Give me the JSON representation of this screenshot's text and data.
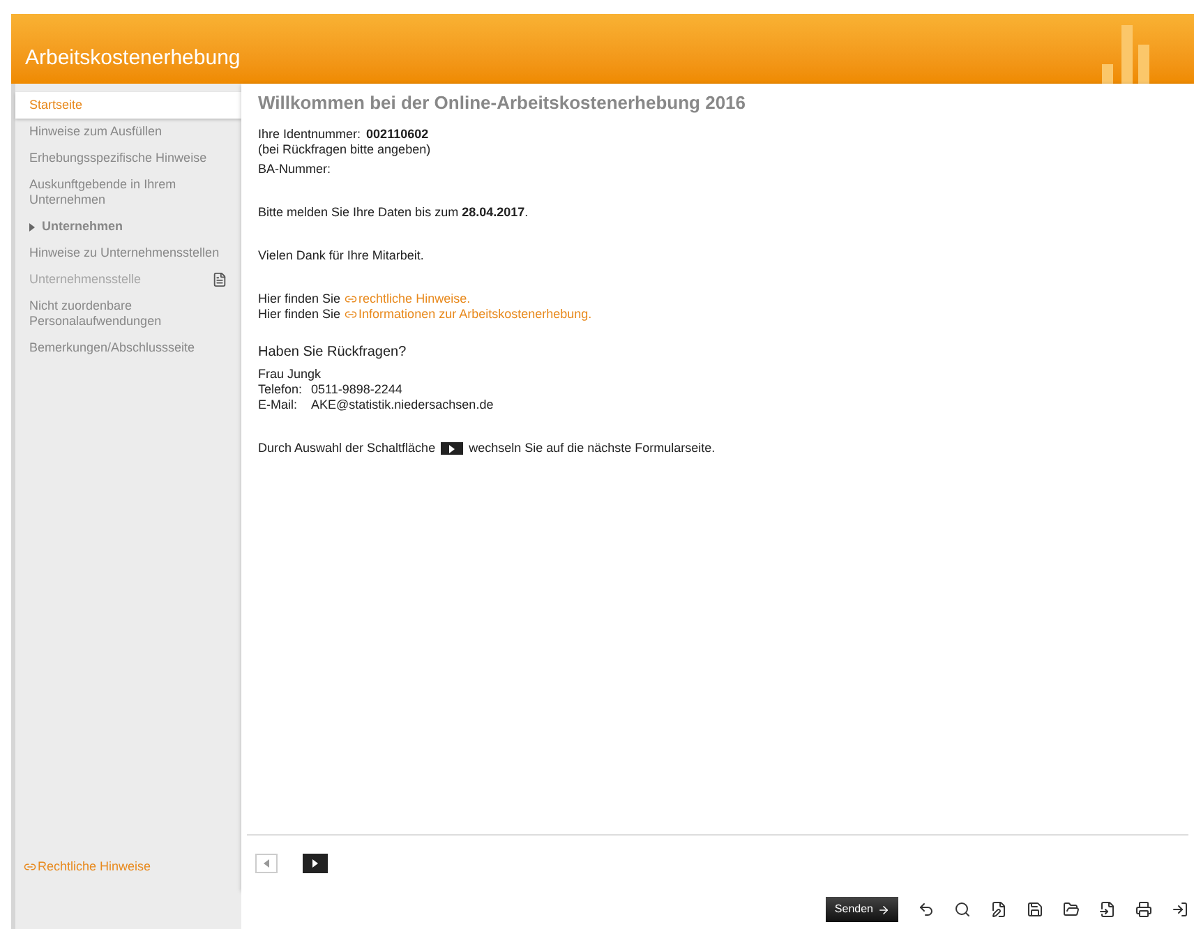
{
  "header": {
    "title": "Arbeitskostenerhebung"
  },
  "sidebar": {
    "items": [
      {
        "label": "Startseite",
        "kind": "item",
        "selected": true,
        "disabled": false
      },
      {
        "label": "Hinweise zum Ausfüllen",
        "kind": "item",
        "selected": false,
        "disabled": false
      },
      {
        "label": "Erhebungsspezifische Hinweise",
        "kind": "item",
        "selected": false,
        "disabled": false
      },
      {
        "label": "Auskunftgebende in Ihrem Unternehmen",
        "kind": "item",
        "selected": false,
        "disabled": false
      },
      {
        "label": "Unternehmen",
        "kind": "group",
        "selected": false,
        "disabled": false
      },
      {
        "label": "Hinweise zu Unternehmensstellen",
        "kind": "item",
        "selected": false,
        "disabled": false
      },
      {
        "label": "Unternehmensstelle",
        "kind": "page",
        "selected": false,
        "disabled": true
      },
      {
        "label": "Nicht zuordenbare Personalaufwendungen",
        "kind": "item",
        "selected": false,
        "disabled": false
      },
      {
        "label": "Bemerkungen/Abschlussseite",
        "kind": "item",
        "selected": false,
        "disabled": false
      }
    ],
    "footer_link": "Rechtliche Hinweise"
  },
  "content": {
    "heading": "Willkommen bei der Online-Arbeitskostenerhebung 2016",
    "id_label": "Ihre Identnummer:",
    "id_value": "002110602",
    "id_note": "(bei Rückfragen bitte angeben)",
    "ba_label": "BA-Nummer:",
    "deadline": "Bitte melden Sie Ihre Daten bis zum **28.04.2017**.",
    "thanks": "Vielen Dank für Ihre Mitarbeit.",
    "links": [
      {
        "prefix": "Hier finden Sie",
        "link": "rechtliche Hinweise."
      },
      {
        "prefix": "Hier finden Sie",
        "link": "Informationen zur Arbeitskostenerhebung."
      }
    ],
    "contact_heading": "Haben Sie Rückfragen?",
    "contact_name": "Frau Jungk",
    "contact_rows": [
      {
        "label": "Telefon:",
        "value": "0511-9898-2244"
      },
      {
        "label": "E-Mail:",
        "value": "AKE@statistik.niedersachsen.de"
      }
    ],
    "hint_before": "Durch Auswahl der Schaltfläche",
    "hint_after": "wechseln Sie auf die nächste Formularseite."
  },
  "toolbar": {
    "send": "Senden"
  }
}
